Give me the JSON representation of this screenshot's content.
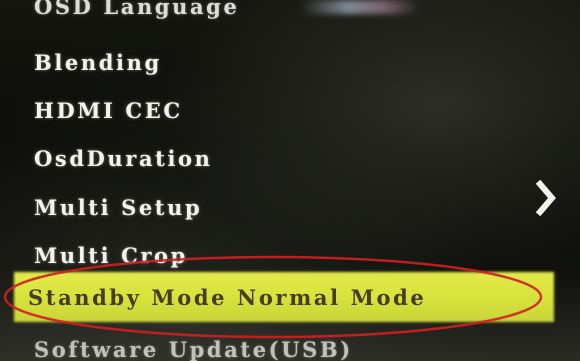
{
  "menu": {
    "items": [
      {
        "label": "OSD Language"
      },
      {
        "label": "Blending"
      },
      {
        "label": "HDMI CEC"
      },
      {
        "label": "OsdDuration"
      },
      {
        "label": "Multi Setup"
      },
      {
        "label": "Multi Crop"
      },
      {
        "label": "Standby Mode Normal Mode"
      },
      {
        "label": "Software Update(USB)"
      }
    ],
    "selected_index": 6
  },
  "icons": {
    "next": "chevron-right-icon"
  },
  "colors": {
    "highlight": "#d6e23a",
    "text": "#f3f3ec",
    "annotation": "#d02020"
  }
}
